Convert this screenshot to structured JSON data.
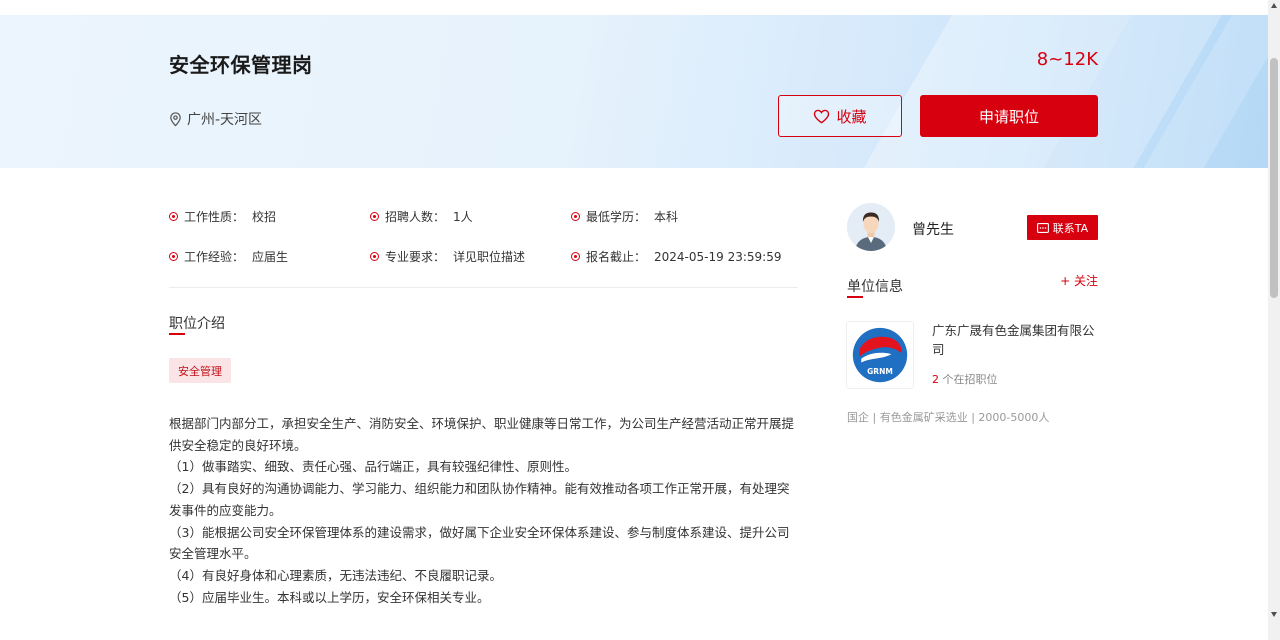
{
  "job": {
    "title": "安全环保管理岗",
    "salary": "8~12K",
    "location": "广州-天河区",
    "favorite_label": "收藏",
    "apply_label": "申请职位"
  },
  "info": [
    {
      "label": "工作性质：",
      "value": "校招"
    },
    {
      "label": "招聘人数：",
      "value": "1人"
    },
    {
      "label": "最低学历：",
      "value": "本科"
    },
    {
      "label": "工作经验：",
      "value": "应届生"
    },
    {
      "label": "专业要求：",
      "value": "详见职位描述"
    },
    {
      "label": "报名截止：",
      "value": "2024-05-19 23:59:59"
    }
  ],
  "intro": {
    "section_title": "职位介绍",
    "tag": "安全管理",
    "paragraphs": [
      "根据部门内部分工，承担安全生产、消防安全、环境保护、职业健康等日常工作，为公司生产经营活动正常开展提供安全稳定的良好环境。",
      "（1）做事踏实、细致、责任心强、品行端正，具有较强纪律性、原则性。",
      "（2）具有良好的沟通协调能力、学习能力、组织能力和团队协作精神。能有效推动各项工作正常开展，有处理突发事件的应变能力。",
      "（3）能根据公司安全环保管理体系的建设需求，做好属下企业安全环保体系建设、参与制度体系建设、提升公司安全管理水平。",
      "（4）有良好身体和心理素质，无违法违纪、不良履职记录。",
      "（5）应届毕业生。本科或以上学历，安全环保相关专业。"
    ]
  },
  "contact": {
    "name": "曾先生",
    "button_label": "联系TA"
  },
  "company": {
    "section_title": "单位信息",
    "follow_label": "+ 关注",
    "name": "广东广晟有色金属集团有限公司",
    "logo_text": "GRNM",
    "jobs_count": "2",
    "jobs_suffix": " 个在招职位",
    "meta": "国企 | 有色金属矿采选业 | 2000-5000人"
  },
  "colors": {
    "accent": "#d7000f"
  }
}
